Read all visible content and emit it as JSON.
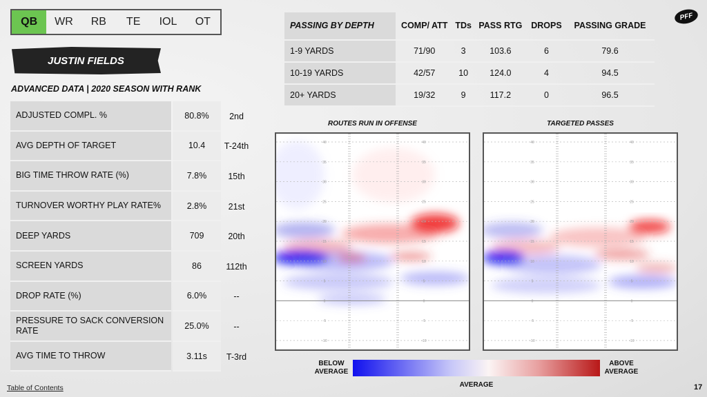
{
  "tabs": [
    {
      "label": "QB",
      "active": true
    },
    {
      "label": "WR"
    },
    {
      "label": "RB"
    },
    {
      "label": "TE"
    },
    {
      "label": "IOL"
    },
    {
      "label": "OT"
    }
  ],
  "player_name": "JUSTIN FIELDS",
  "subtitle": "ADVANCED DATA | 2020 SEASON WITH RANK",
  "advanced": [
    {
      "label": "ADJUSTED COMPL. %",
      "value": "80.8%",
      "rank": "2nd"
    },
    {
      "label": "AVG DEPTH OF TARGET",
      "value": "10.4",
      "rank": "T-24th"
    },
    {
      "label": "BIG TIME THROW RATE (%)",
      "value": "7.8%",
      "rank": "15th"
    },
    {
      "label": "TURNOVER WORTHY PLAY RATE%",
      "value": "2.8%",
      "rank": "21st"
    },
    {
      "label": "DEEP YARDS",
      "value": "709",
      "rank": "20th"
    },
    {
      "label": "SCREEN YARDS",
      "value": "86",
      "rank": "112th"
    },
    {
      "label": "DROP RATE (%)",
      "value": "6.0%",
      "rank": "--"
    },
    {
      "label": "PRESSURE TO SACK CONVERSION RATE",
      "value": "25.0%",
      "rank": "--"
    },
    {
      "label": "AVG TIME TO THROW",
      "value": "3.11s",
      "rank": "T-3rd"
    }
  ],
  "passing_by_depth": {
    "headers": [
      "PASSING BY DEPTH",
      "COMP/ ATT",
      "TDs",
      "PASS RTG",
      "DROPS",
      "PASSING GRADE"
    ],
    "rows": [
      [
        "1-9 YARDS",
        "71/90",
        "3",
        "103.6",
        "6",
        "79.6"
      ],
      [
        "10-19 YARDS",
        "42/57",
        "10",
        "124.0",
        "4",
        "94.5"
      ],
      [
        "20+ YARDS",
        "19/32",
        "9",
        "117.2",
        "0",
        "96.5"
      ]
    ]
  },
  "heatmaps": [
    {
      "title": "ROUTES RUN IN OFFENSE"
    },
    {
      "title": "TARGETED PASSES"
    }
  ],
  "yard_labels": [
    "40",
    "35",
    "30",
    "25",
    "20",
    "15",
    "10",
    "5",
    "0",
    "-5",
    "-10"
  ],
  "legend": {
    "below": "BELOW AVERAGE",
    "average": "AVERAGE",
    "above": "ABOVE AVERAGE",
    "colors": {
      "below": "#1010ee",
      "above": "#b81818"
    }
  },
  "footer": {
    "toc": "Table of Contents",
    "page": "17"
  },
  "logo": "PFF"
}
